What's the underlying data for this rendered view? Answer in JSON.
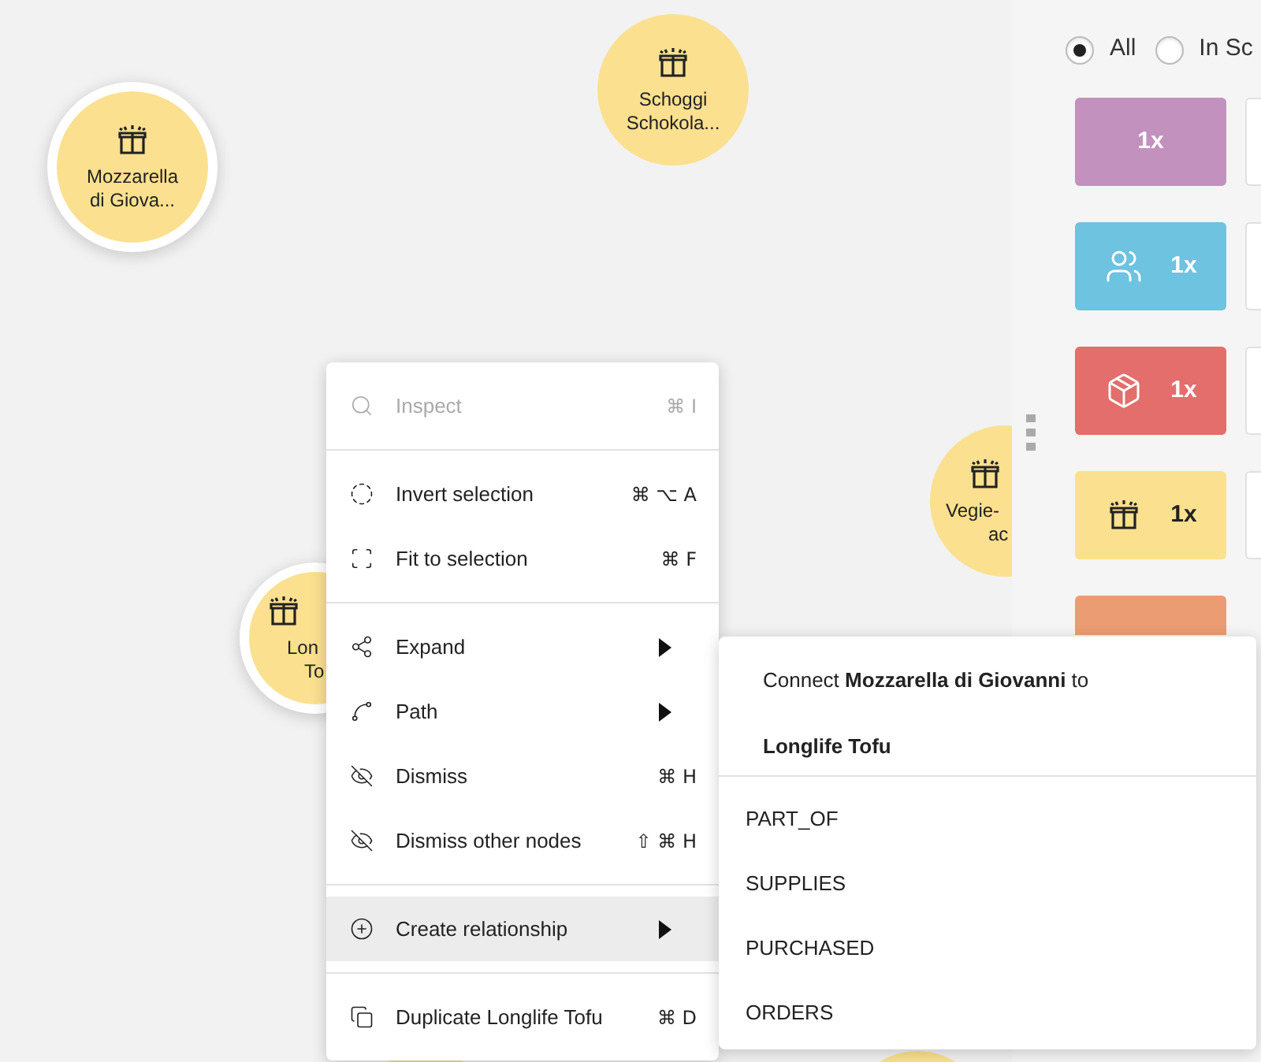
{
  "canvas": {
    "nodes": [
      {
        "lines": [
          "Mozzarella",
          "di Giova..."
        ],
        "selected": true
      },
      {
        "lines": [
          "Schoggi",
          "Schokola..."
        ],
        "selected": false
      },
      {
        "lines": [
          "Vegie-",
          "ac"
        ],
        "selected": false
      },
      {
        "lines": [
          "Lon",
          "To"
        ],
        "selected": true
      },
      {
        "selected": false
      },
      {
        "selected": false
      }
    ]
  },
  "panel": {
    "filters": [
      {
        "label": "All",
        "selected": true
      },
      {
        "label": "In Sc",
        "selected": false
      }
    ],
    "categories": [
      {
        "kind": "plain",
        "color": "#c291be",
        "count": "1x"
      },
      {
        "kind": "people",
        "color": "#6dc3e0",
        "count": "1x"
      },
      {
        "kind": "box",
        "color": "#e36e6b",
        "count": "1x"
      },
      {
        "kind": "gift",
        "color": "#fbe08f",
        "count": "1x"
      },
      {
        "kind": "plain",
        "color": "#ec9c72"
      }
    ]
  },
  "context_menu": {
    "sections": [
      [
        {
          "label": "Inspect",
          "shortcut": "⌘ I",
          "disabled": true,
          "highlighted": false,
          "has_submenu": false
        }
      ],
      [
        {
          "label": "Invert selection",
          "shortcut": "⌘ ⌥ A",
          "disabled": false,
          "highlighted": false,
          "has_submenu": false
        },
        {
          "label": "Fit to selection",
          "shortcut": "⌘ F",
          "disabled": false,
          "highlighted": false,
          "has_submenu": false
        }
      ],
      [
        {
          "label": "Expand",
          "disabled": false,
          "highlighted": false,
          "has_submenu": true
        },
        {
          "label": "Path",
          "disabled": false,
          "highlighted": false,
          "has_submenu": true
        },
        {
          "label": "Dismiss",
          "shortcut": "⌘ H",
          "disabled": false,
          "highlighted": false,
          "has_submenu": false
        },
        {
          "label": "Dismiss other nodes",
          "shortcut": "⇧ ⌘ H",
          "disabled": false,
          "highlighted": false,
          "has_submenu": false
        }
      ],
      [
        {
          "label": "Create relationship",
          "disabled": false,
          "highlighted": true,
          "has_submenu": true
        }
      ],
      [
        {
          "label": "Duplicate Longlife Tofu",
          "shortcut": "⌘ D",
          "disabled": false,
          "highlighted": false,
          "has_submenu": false
        }
      ]
    ]
  },
  "submenu": {
    "header": "Connect **Mozzarella di Giovanni** to",
    "target": "Longlife Tofu",
    "items": [
      "PART_OF",
      "SUPPLIES",
      "PURCHASED",
      "ORDERS"
    ]
  }
}
